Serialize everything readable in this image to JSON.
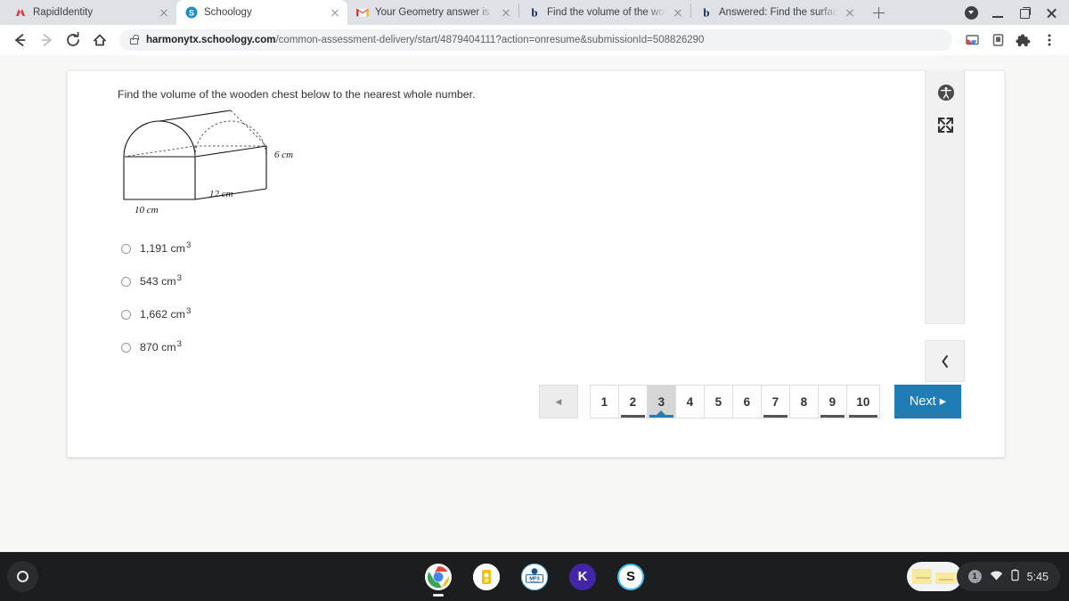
{
  "browser": {
    "tabs": [
      {
        "title": "RapidIdentity",
        "favicon": "rapididentity-icon",
        "active": false
      },
      {
        "title": "Schoology",
        "favicon": "schoology-icon",
        "active": true
      },
      {
        "title": "Your Geometry answer is ready",
        "favicon": "gmail-icon",
        "active": false
      },
      {
        "title": "Find the volume of the wooden",
        "favicon": "brainly-icon",
        "active": false
      },
      {
        "title": "Answered: Find the surface area",
        "favicon": "brainly-icon",
        "active": false
      }
    ],
    "new_tab_label": "+",
    "window_controls": [
      "downloads-icon",
      "minimize-icon",
      "maximize-icon",
      "close-icon"
    ],
    "nav": {
      "back": "back-arrow-icon",
      "forward": "forward-arrow-icon",
      "reload": "reload-icon",
      "home": "home-icon"
    },
    "url": {
      "domain": "harmonytx.schoology.com",
      "path": "/common-assessment-delivery/start/4879404111?action=onresume&submissionId=508826290",
      "lock": "lock-icon"
    },
    "toolbar_right": [
      "cast-icon",
      "reading-mode-icon",
      "extensions-icon",
      "chrome-menu-icon"
    ]
  },
  "assessment": {
    "question": "Find the volume of the wooden chest below to the nearest whole number.",
    "figure": {
      "name": "wooden-chest-diagram",
      "labels": {
        "height": "6 cm",
        "depth": "12 cm",
        "width": "10 cm"
      }
    },
    "options": [
      {
        "value": "1,191 cm",
        "exponent": "3",
        "selected": false
      },
      {
        "value": "543 cm",
        "exponent": "3",
        "selected": false
      },
      {
        "value": "1,662 cm",
        "exponent": "3",
        "selected": false
      },
      {
        "value": "870 cm",
        "exponent": "3",
        "selected": false
      }
    ],
    "pagination": {
      "prev_label": "◀",
      "next_label": "Next ▸",
      "current": "3",
      "pages": [
        {
          "label": "1",
          "state": "normal"
        },
        {
          "label": "2",
          "state": "answered"
        },
        {
          "label": "3",
          "state": "current"
        },
        {
          "label": "4",
          "state": "normal"
        },
        {
          "label": "5",
          "state": "normal"
        },
        {
          "label": "6",
          "state": "normal"
        },
        {
          "label": "7",
          "state": "answered"
        },
        {
          "label": "8",
          "state": "normal"
        },
        {
          "label": "9",
          "state": "answered"
        },
        {
          "label": "10",
          "state": "answered"
        }
      ]
    },
    "tools": {
      "accessibility": "accessibility-icon",
      "fullscreen": "fullscreen-icon",
      "collapse": "collapse-chevron-icon"
    },
    "colors": {
      "accent": "#1f7cb4",
      "current_page_underline": "#2080b8",
      "answered_underline": "#555555"
    }
  },
  "shelf": {
    "launcher": "launcher-icon",
    "apps": [
      {
        "name": "chrome-icon",
        "label": ""
      },
      {
        "name": "keep-icon",
        "label": ""
      },
      {
        "name": "mp3-icon",
        "label": "MP3"
      },
      {
        "name": "kahoot-icon",
        "label": "K"
      },
      {
        "name": "schoology-icon",
        "label": "S"
      }
    ],
    "tray": {
      "notification_count": "1",
      "wifi": "wifi-icon",
      "battery": "battery-icon",
      "time": "5:45"
    }
  }
}
